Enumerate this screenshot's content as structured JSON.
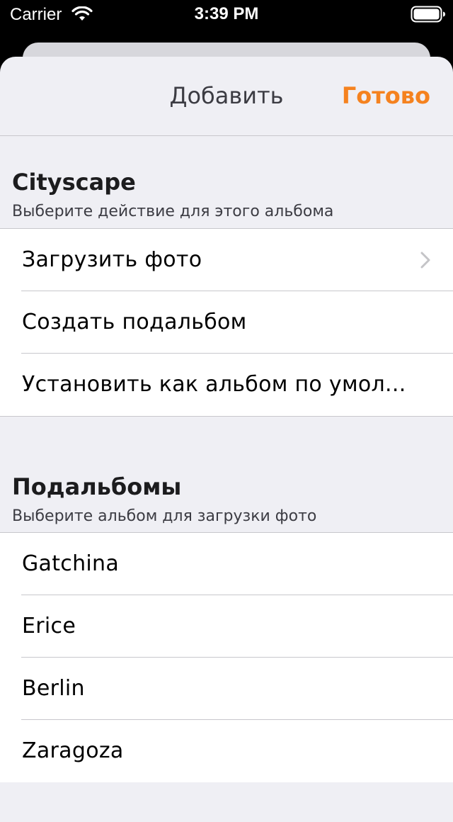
{
  "status_bar": {
    "carrier": "Carrier",
    "time": "3:39 PM"
  },
  "navbar": {
    "title": "Добавить",
    "done_label": "Готово"
  },
  "album_section": {
    "title": "Cityscape",
    "subtitle": "Выберите действие для этого альбома",
    "actions": [
      {
        "label": "Загрузить фото",
        "accessory": "chevron-right-icon"
      },
      {
        "label": "Создать подальбом"
      },
      {
        "label": "Установить как альбом по умол..."
      }
    ]
  },
  "subalbums_section": {
    "title": "Подальбомы",
    "subtitle": "Выберите альбом для загрузки фото",
    "items": [
      {
        "label": "Gatchina"
      },
      {
        "label": "Erice"
      },
      {
        "label": "Berlin"
      },
      {
        "label": "Zaragoza"
      }
    ]
  },
  "colors": {
    "accent": "#f5821f",
    "background": "#efeff4",
    "separator": "#c8c7cc"
  }
}
